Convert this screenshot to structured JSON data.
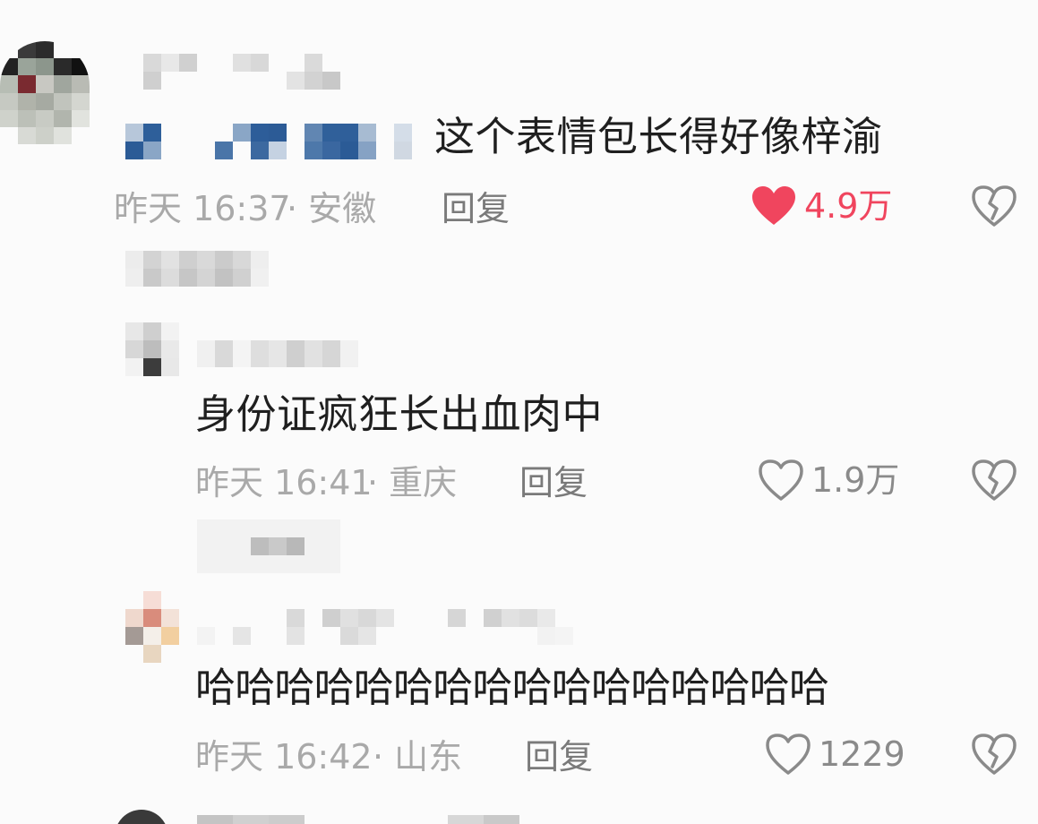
{
  "comments": [
    {
      "text": "这个表情包长得好像梓渝",
      "time": "昨天 16:37",
      "location": "· 安徽",
      "reply_label": "回复",
      "likes": "4.9万",
      "liked": true
    },
    {
      "text": "身份证疯狂长出血肉中",
      "time": "昨天 16:41",
      "location": "· 重庆",
      "reply_label": "回复",
      "likes": "1.9万",
      "liked": false
    },
    {
      "text": "哈哈哈哈哈哈哈哈哈哈哈哈哈哈哈哈",
      "time": "昨天 16:42",
      "location": "· 山东",
      "reply_label": "回复",
      "likes": "1229",
      "liked": false
    }
  ],
  "colors": {
    "liked_red": "#f0455e",
    "text_primary": "#1f1f1f",
    "text_meta": "#a9a9a9",
    "icon_grey": "#8a8a8a"
  },
  "icons": {
    "like": "heart-icon",
    "dislike": "broken-heart-icon"
  }
}
